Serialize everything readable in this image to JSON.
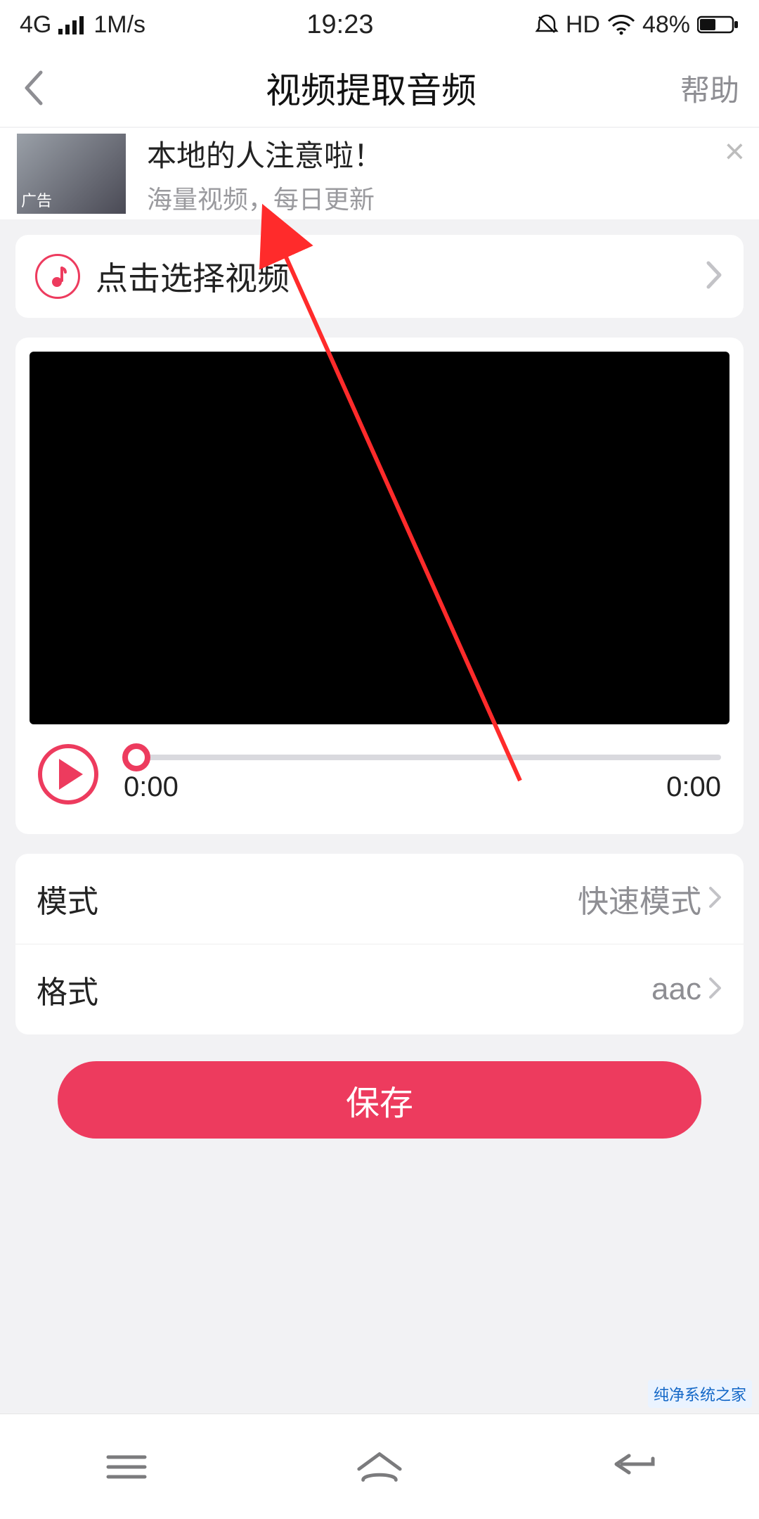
{
  "status": {
    "network": "4G",
    "speed": "1M/s",
    "time": "19:23",
    "hd": "HD",
    "battery": "48%"
  },
  "nav": {
    "title": "视频提取音频",
    "help": "帮助"
  },
  "ad": {
    "title": "本地的人注意啦！",
    "subtitle": "海量视频，每日更新",
    "tag": "广告"
  },
  "select": {
    "label": "点击选择视频"
  },
  "player": {
    "current": "0:00",
    "duration": "0:00"
  },
  "settings": {
    "mode_label": "模式",
    "mode_value": "快速模式",
    "format_label": "格式",
    "format_value": "aac"
  },
  "actions": {
    "save": "保存"
  },
  "watermark": "纯净系统之家"
}
